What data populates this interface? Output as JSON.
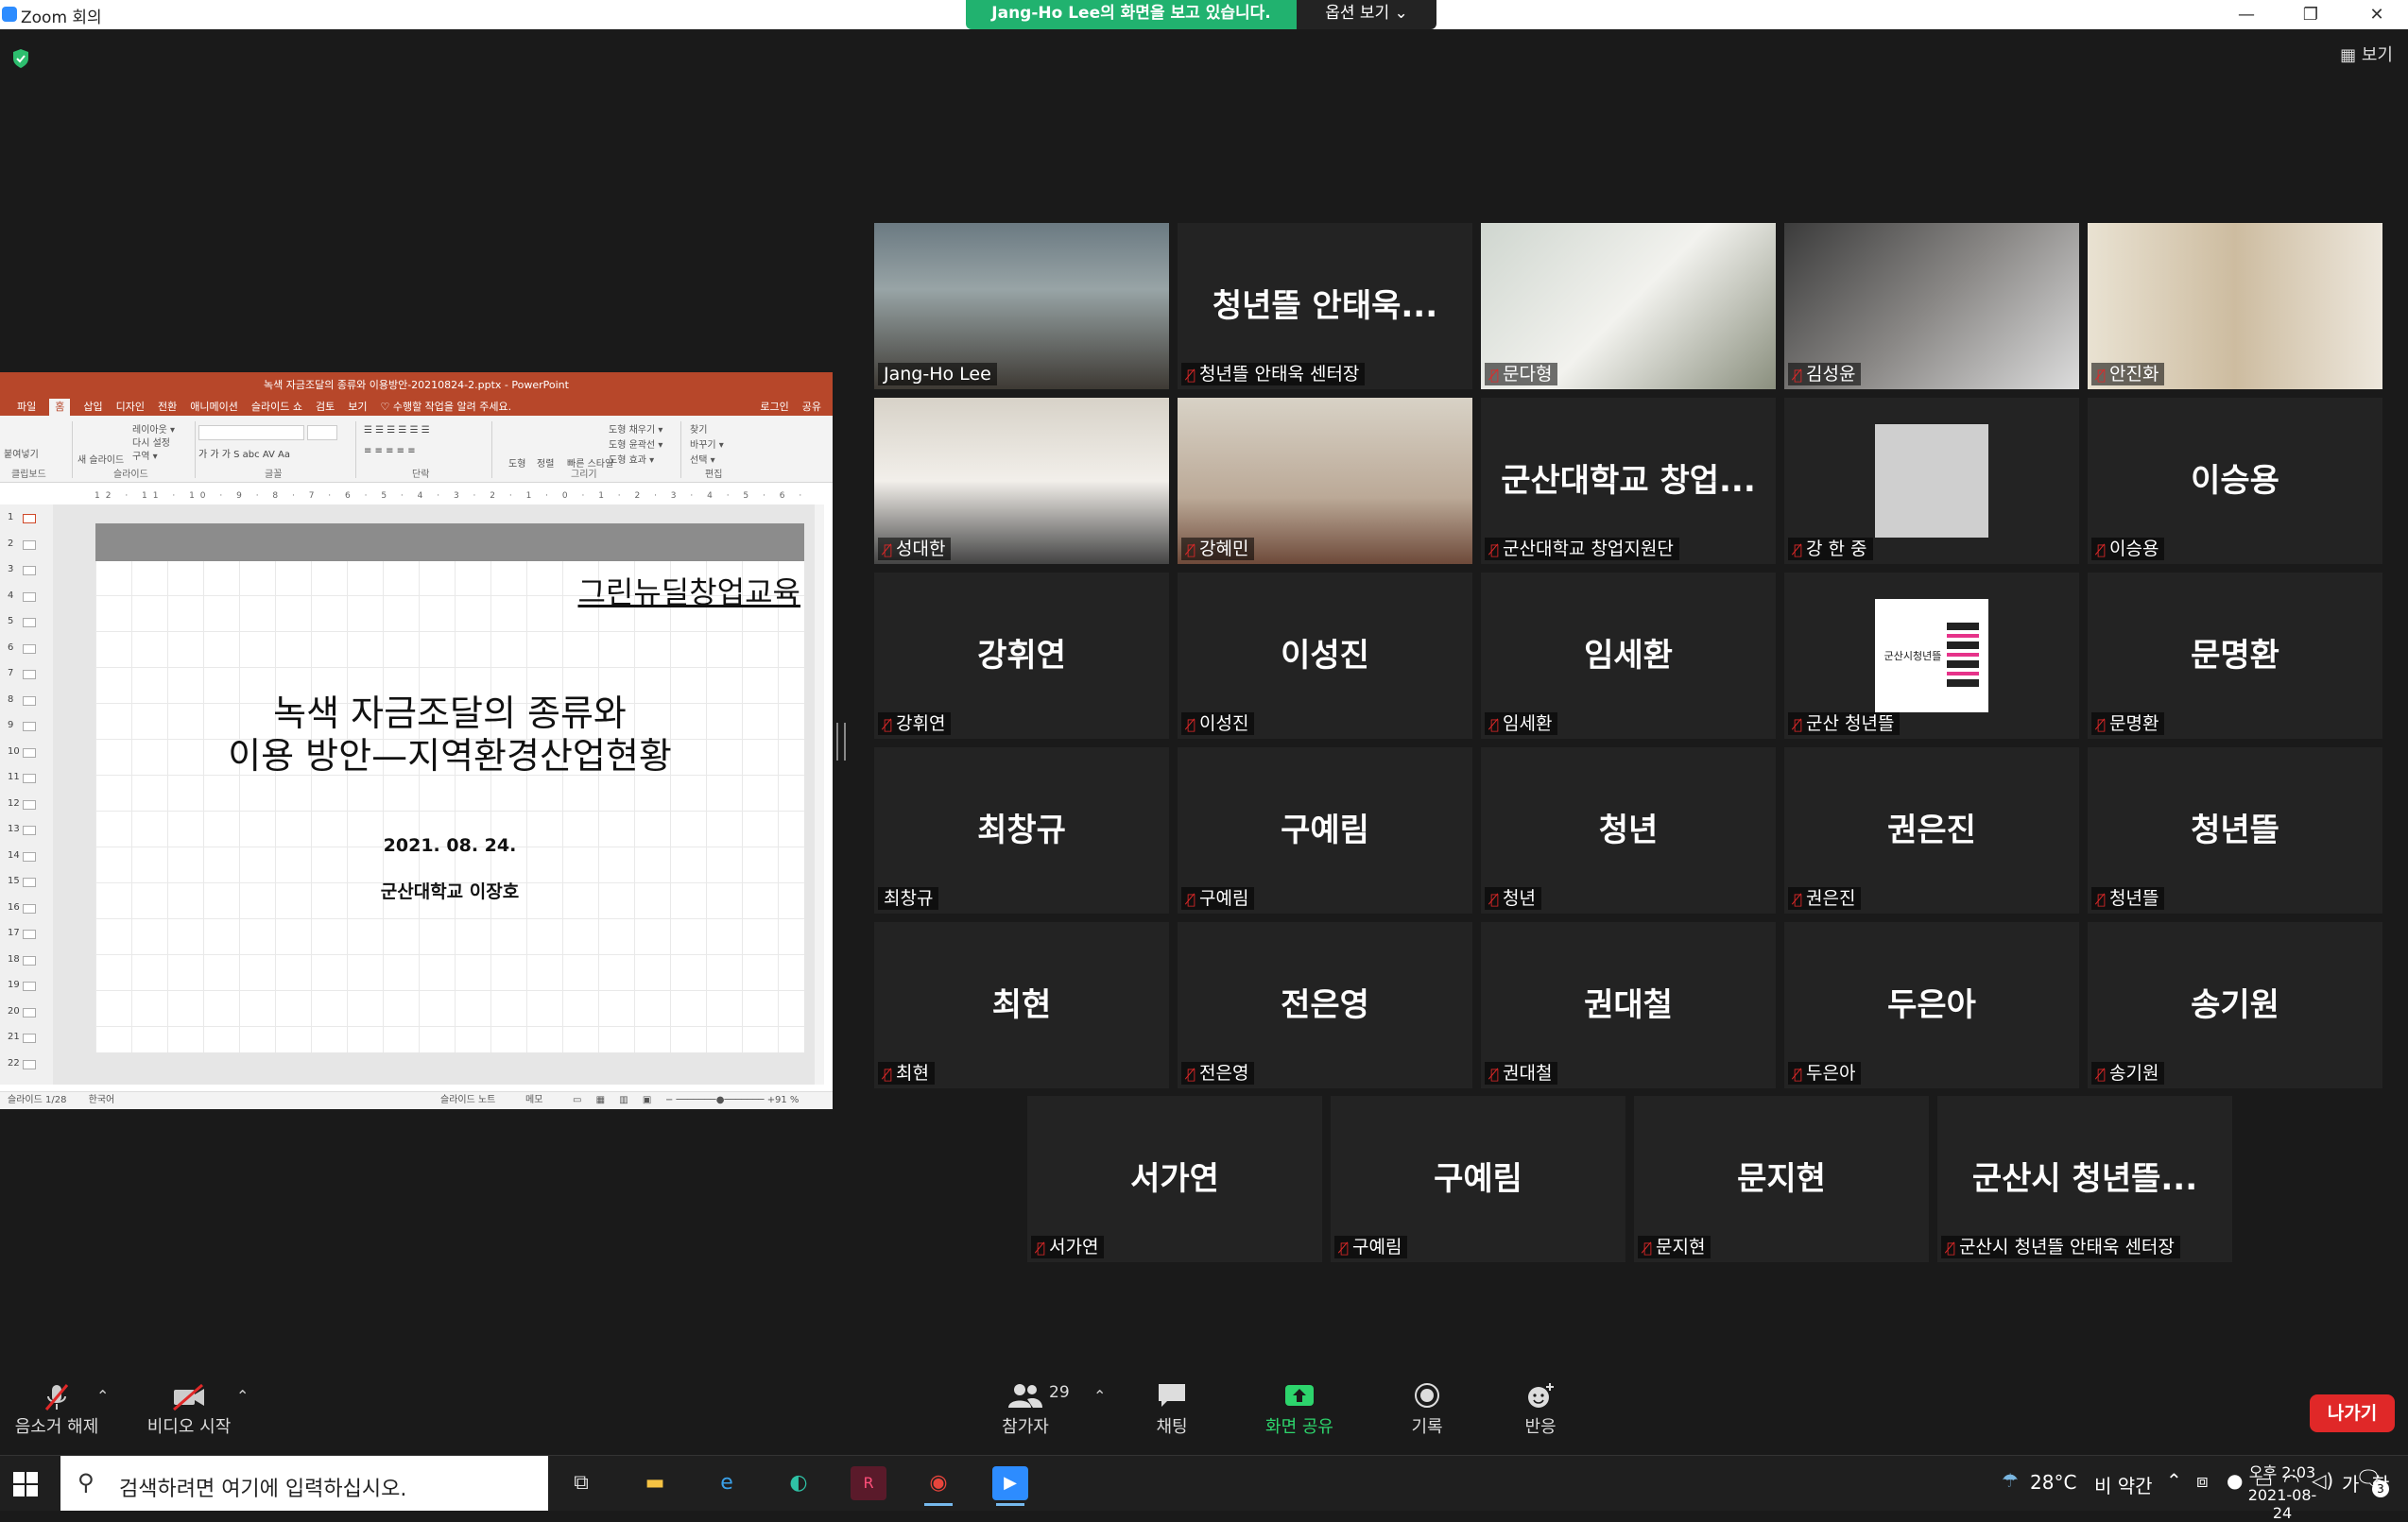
{
  "window": {
    "title": "Zoom 회의",
    "sharing_notice": "Jang-Ho Lee의 화면을 보고 있습니다.",
    "view_options": "옵션 보기 ⌄",
    "view_button": "보기",
    "minimize": "—",
    "maximize": "❐",
    "close": "✕"
  },
  "ppt": {
    "title": "녹색 자금조달의 종류와 이용방안-20210824-2.pptx - PowerPoint",
    "menu": [
      "파일",
      "홈",
      "삽입",
      "디자인",
      "전환",
      "애니메이션",
      "슬라이드 쇼",
      "검토",
      "보기",
      "♡ 수행할 작업을 알려 주세요."
    ],
    "menu_right": [
      "로그인",
      "공유"
    ],
    "ribbon_groups": [
      "클립보드",
      "슬라이드",
      "글꼴",
      "단락",
      "그리기",
      "편집"
    ],
    "ribbon_items": [
      "붙여넣기",
      "새 슬라이드",
      "레이아웃 ▾",
      "다시 설정",
      "구역 ▾",
      "도형",
      "정렬",
      "빠른 스타일",
      "도형 채우기 ▾",
      "도형 윤곽선 ▾",
      "도형 효과 ▾",
      "찾기",
      "바꾸기 ▾",
      "선택 ▾"
    ],
    "ruler": "12 · 11 · 10 · 9 · 8 · 7 · 6 · 5 · 4 · 3 · 2 · 1 · 0 · 1 · 2 · 3 · 4 · 5 · 6 · 7 · 8 · 9 · 10 · 11 · 12",
    "slide_numbers": [
      "1",
      "2",
      "3",
      "4",
      "5",
      "6",
      "7",
      "8",
      "9",
      "10",
      "11",
      "12",
      "13",
      "14",
      "15",
      "16",
      "17",
      "18",
      "19",
      "20",
      "21",
      "22"
    ],
    "slide": {
      "header": "그린뉴딜창업교육",
      "title_line1": "녹색 자금조달의 종류와",
      "title_line2": "이용 방안—지역환경산업현황",
      "date": "2021. 08. 24.",
      "author": "군산대학교 이장호"
    },
    "status_left": "슬라이드 1/28",
    "status_lang": "한국어",
    "status_notes": "슬라이드 노트",
    "status_comments": "메모",
    "zoom": "91 %"
  },
  "participants": [
    {
      "big": "",
      "label": "Jang-Ho Lee",
      "muted": false,
      "video": "teacher"
    },
    {
      "big": "청년뜰 안태욱...",
      "label": "청년뜰 안태욱 센터장",
      "muted": true
    },
    {
      "big": "",
      "label": "문다형",
      "muted": true,
      "video": "v1"
    },
    {
      "big": "",
      "label": "김성윤",
      "muted": true,
      "video": "v2"
    },
    {
      "big": "",
      "label": "안진화",
      "muted": true,
      "video": "v3"
    },
    {
      "big": "",
      "label": "성대한",
      "muted": true,
      "video": "v4"
    },
    {
      "big": "",
      "label": "강혜민",
      "muted": true,
      "video": "v5"
    },
    {
      "big": "군산대학교 창업...",
      "label": "군산대학교 창업지원단",
      "muted": true
    },
    {
      "big": "",
      "label": "강 한 중",
      "muted": true,
      "video": "gray"
    },
    {
      "big": "이승용",
      "label": "이승용",
      "muted": true
    },
    {
      "big": "강휘연",
      "label": "강휘연",
      "muted": true
    },
    {
      "big": "이성진",
      "label": "이성진",
      "muted": true
    },
    {
      "big": "임세환",
      "label": "임세환",
      "muted": true
    },
    {
      "big": "",
      "label": "군산 청년뜰",
      "muted": true,
      "video": "logo",
      "logo_text": "군산시청년뜰"
    },
    {
      "big": "문명환",
      "label": "문명환",
      "muted": true
    },
    {
      "big": "최창규",
      "label": "최창규",
      "muted": false
    },
    {
      "big": "구예림",
      "label": "구예림",
      "muted": true
    },
    {
      "big": "청년",
      "label": "청년",
      "muted": true
    },
    {
      "big": "권은진",
      "label": "권은진",
      "muted": true
    },
    {
      "big": "청년뜰",
      "label": "청년뜰",
      "muted": true
    },
    {
      "big": "최현",
      "label": "최현",
      "muted": true
    },
    {
      "big": "전은영",
      "label": "전은영",
      "muted": true
    },
    {
      "big": "권대철",
      "label": "권대철",
      "muted": true
    },
    {
      "big": "두은아",
      "label": "두은아",
      "muted": true
    },
    {
      "big": "송기원",
      "label": "송기원",
      "muted": true
    },
    {
      "big": "서가연",
      "label": "서가연",
      "muted": true
    },
    {
      "big": "구예림",
      "label": "구예림",
      "muted": true
    },
    {
      "big": "문지현",
      "label": "문지현",
      "muted": true
    },
    {
      "big": "군산시 청년뜰...",
      "label": "군산시 청년뜰 안태욱 센터장",
      "muted": true
    }
  ],
  "toolbar": {
    "mute": "음소거 해제",
    "video": "비디오 시작",
    "participants": "참가자",
    "participant_count": "29",
    "chat": "채팅",
    "share": "화면 공유",
    "record": "기록",
    "reactions": "반응",
    "leave": "나가기"
  },
  "taskbar": {
    "search_placeholder": "검색하려면 여기에 입력하십시오.",
    "weather_temp": "28°C",
    "weather_text": "비 약간",
    "ime_1": "가",
    "ime_2": "한",
    "time": "오후 2:03",
    "date": "2021-08-24",
    "notif_count": "3"
  },
  "colors": {
    "share_green": "#21b26f",
    "active_speaker": "#c9e04a",
    "leave_red": "#e02828",
    "ppt_red": "#b7472a"
  }
}
